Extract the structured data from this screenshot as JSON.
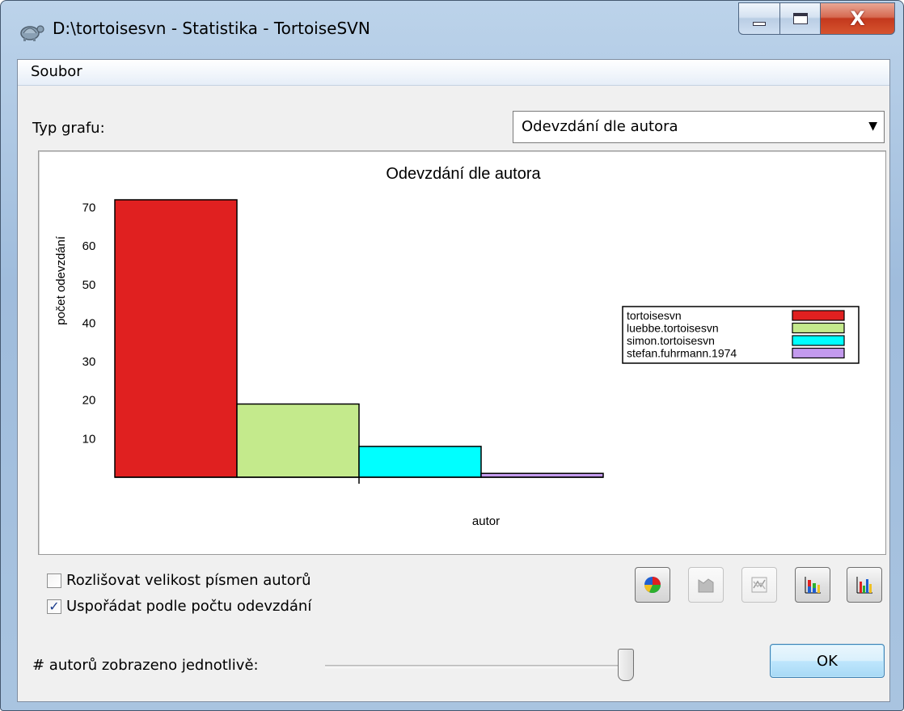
{
  "window": {
    "title": "D:\\tortoisesvn - Statistika - TortoiseSVN",
    "icon": "tortoise-icon",
    "caption_close": "X"
  },
  "menu": {
    "items": [
      "Soubor"
    ]
  },
  "graph_type": {
    "label": "Typ grafu:",
    "selected": "Odevzdání dle autora"
  },
  "chart_data": {
    "type": "bar",
    "title": "Odevzdání dle autora",
    "xlabel": "autor",
    "ylabel": "počet odevzdání",
    "yticks": [
      10,
      20,
      30,
      40,
      50,
      60,
      70
    ],
    "ylim": [
      0,
      72
    ],
    "grid": false,
    "legend_position": "right",
    "categories": [
      "tortoisesvn",
      "luebbe.tortoisesvn",
      "simon.tortoisesvn",
      "stefan.fuhrmann.1974"
    ],
    "values": [
      72,
      19,
      8,
      1
    ],
    "colors": [
      "#e02020",
      "#c4ea8c",
      "#00ffff",
      "#c39aee"
    ]
  },
  "options": {
    "case_sensitive": {
      "label": "Rozlišovat velikost písmen autorů",
      "checked": false
    },
    "sort_by_commits": {
      "label": "Uspořádat podle počtu odevzdání",
      "checked": true
    }
  },
  "toolbar": {
    "buttons": [
      {
        "name": "pie-chart-icon",
        "enabled": true
      },
      {
        "name": "area-chart-icon",
        "enabled": false
      },
      {
        "name": "line-chart-icon",
        "enabled": false
      },
      {
        "name": "stacked-bar-chart-icon",
        "enabled": true
      },
      {
        "name": "bar-chart-icon",
        "enabled": true
      }
    ]
  },
  "authors_slider": {
    "label": "# autorů zobrazeno jednotlivě:",
    "value_fraction": 1.0
  },
  "ok_button": {
    "label": "OK"
  }
}
